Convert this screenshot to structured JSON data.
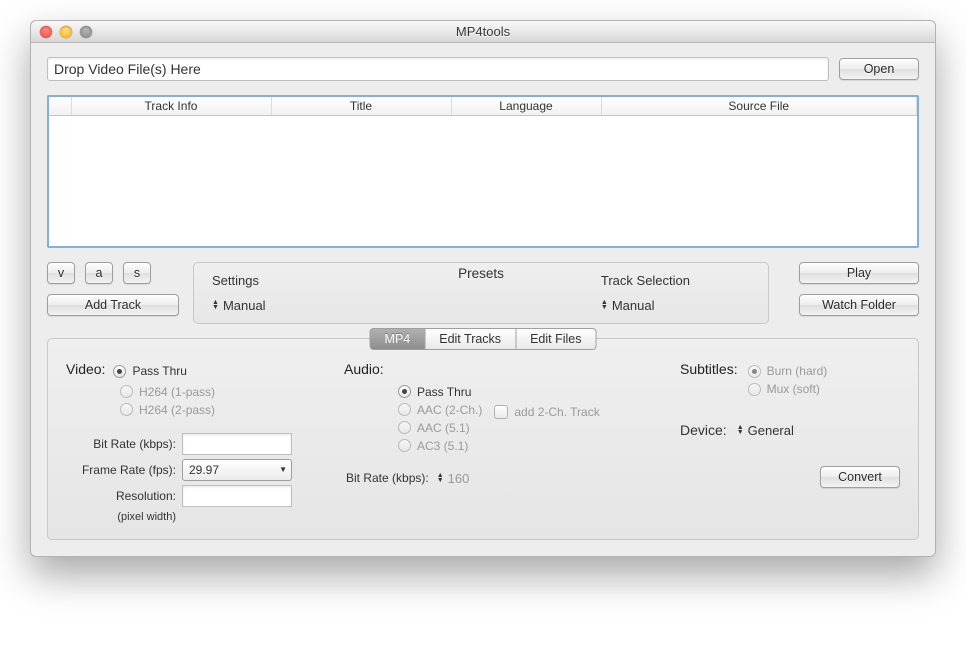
{
  "window": {
    "title": "MP4tools"
  },
  "drop": {
    "placeholder": "Drop Video File(s) Here",
    "open_label": "Open"
  },
  "table": {
    "headers": [
      "",
      "Track Info",
      "Title",
      "Language",
      "Source File"
    ]
  },
  "vas": {
    "v": "v",
    "a": "a",
    "s": "s"
  },
  "add_track_label": "Add Track",
  "presets": {
    "title": "Presets",
    "settings_label": "Settings",
    "settings_value": "Manual",
    "track_label": "Track Selection",
    "track_value": "Manual"
  },
  "right_buttons": {
    "play": "Play",
    "watch": "Watch Folder"
  },
  "tabs": {
    "mp4": "MP4",
    "edit_tracks": "Edit Tracks",
    "edit_files": "Edit Files"
  },
  "video": {
    "heading": "Video:",
    "pass_thru": "Pass Thru",
    "h264_1": "H264 (1-pass)",
    "h264_2": "H264 (2-pass)",
    "bitrate_label": "Bit Rate (kbps):",
    "bitrate_value": "",
    "framerate_label": "Frame Rate (fps):",
    "framerate_value": "29.97",
    "resolution_label": "Resolution:",
    "resolution_value": "",
    "resolution_hint": "(pixel width)"
  },
  "audio": {
    "heading": "Audio:",
    "pass_thru": "Pass Thru",
    "aac2": "AAC (2-Ch.)",
    "aac51": "AAC (5.1)",
    "ac351": "AC3 (5.1)",
    "add2ch": "add 2-Ch. Track",
    "bitrate_label": "Bit Rate (kbps):",
    "bitrate_value": "160"
  },
  "subtitles": {
    "heading": "Subtitles:",
    "burn": "Burn (hard)",
    "mux": "Mux (soft)"
  },
  "device": {
    "label": "Device:",
    "value": "General"
  },
  "convert_label": "Convert"
}
